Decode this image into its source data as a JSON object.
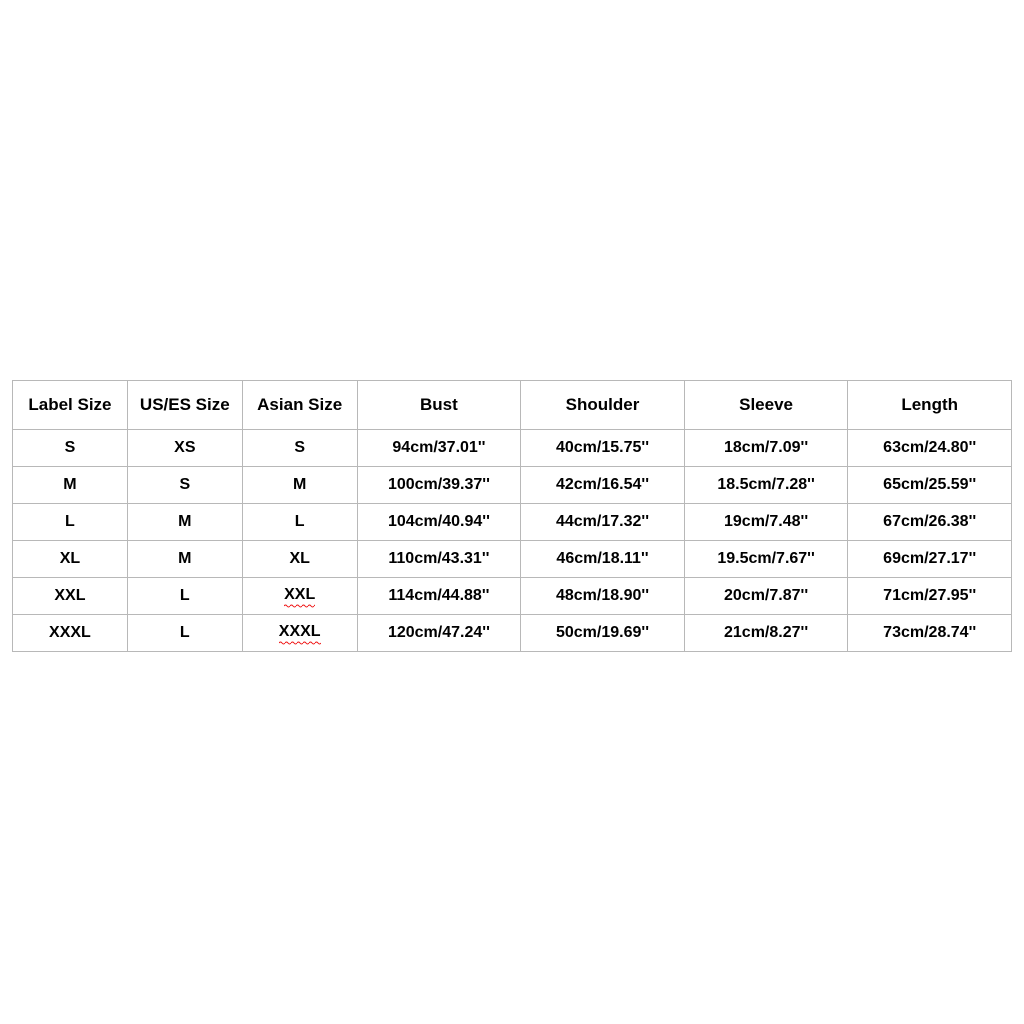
{
  "chart_data": {
    "type": "table",
    "headers": [
      "Label Size",
      "US/ES Size",
      "Asian Size",
      "Bust",
      "Shoulder",
      "Sleeve",
      "Length"
    ],
    "rows": [
      {
        "label": "S",
        "uses": "XS",
        "asian": "S",
        "asian_squiggle": false,
        "bust": "94cm/37.01''",
        "shoulder": "40cm/15.75''",
        "sleeve": "18cm/7.09''",
        "length": "63cm/24.80''"
      },
      {
        "label": "M",
        "uses": "S",
        "asian": "M",
        "asian_squiggle": false,
        "bust": "100cm/39.37''",
        "shoulder": "42cm/16.54''",
        "sleeve": "18.5cm/7.28''",
        "length": "65cm/25.59''"
      },
      {
        "label": "L",
        "uses": "M",
        "asian": "L",
        "asian_squiggle": false,
        "bust": "104cm/40.94''",
        "shoulder": "44cm/17.32''",
        "sleeve": "19cm/7.48''",
        "length": "67cm/26.38''"
      },
      {
        "label": "XL",
        "uses": "M",
        "asian": "XL",
        "asian_squiggle": false,
        "bust": "110cm/43.31''",
        "shoulder": "46cm/18.11''",
        "sleeve": "19.5cm/7.67''",
        "length": "69cm/27.17''"
      },
      {
        "label": "XXL",
        "uses": "L",
        "asian": "XXL",
        "asian_squiggle": true,
        "bust": "114cm/44.88''",
        "shoulder": "48cm/18.90''",
        "sleeve": "20cm/7.87''",
        "length": "71cm/27.95''"
      },
      {
        "label": "XXXL",
        "uses": "L",
        "asian": "XXXL",
        "asian_squiggle": true,
        "bust": "120cm/47.24''",
        "shoulder": "50cm/19.69''",
        "sleeve": "21cm/8.27''",
        "length": "73cm/28.74''"
      }
    ]
  }
}
